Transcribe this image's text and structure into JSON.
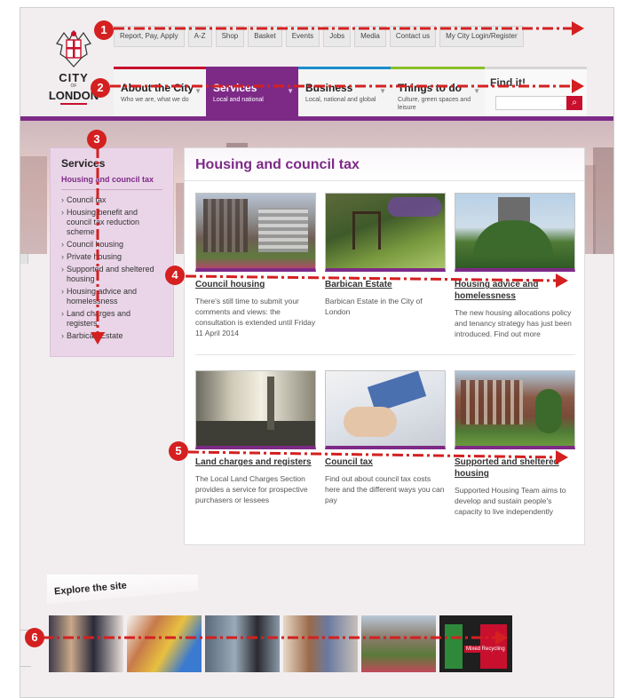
{
  "utility_nav": {
    "items": [
      "Report, Pay, Apply",
      "A-Z",
      "Shop",
      "Basket",
      "Events",
      "Jobs",
      "Media",
      "Contact us",
      "My City Login/Register"
    ]
  },
  "logo": {
    "line1": "CITY",
    "line2": "OF",
    "line3": "LONDON"
  },
  "main_nav": {
    "tabs": [
      {
        "title": "About the City",
        "subtitle": "Who we are, what we do"
      },
      {
        "title": "Services",
        "subtitle": "Local and national"
      },
      {
        "title": "Business",
        "subtitle": "Local, national and global"
      },
      {
        "title": "Things to do",
        "subtitle": "Culture, green spaces and leisure"
      }
    ],
    "find_label": "Find it!",
    "search_placeholder": ""
  },
  "sidebar": {
    "title": "Services",
    "current": "Housing and council tax",
    "items": [
      "Council tax",
      "Housing benefit and council tax reduction scheme",
      "Council housing",
      "Private housing",
      "Supported and sheltered housing",
      "Housing advice and homelessness",
      "Land charges and registers",
      "Barbican Estate"
    ]
  },
  "main": {
    "title": "Housing and council tax",
    "cards": [
      {
        "title": "Council housing",
        "desc": "There's still time to submit your comments and views: the consultation is extended until Friday 11 April 2014"
      },
      {
        "title": "Barbican Estate",
        "desc": "Barbican Estate in the City of London"
      },
      {
        "title": "Housing advice and homelessness",
        "desc": "The new housing allocations policy and tenancy strategy has just been introduced. Find out more"
      },
      {
        "title": "Land charges and registers",
        "desc": "The Local Land Charges Section provides a service for prospective purchasers or lessees"
      },
      {
        "title": "Council tax",
        "desc": "Find out about council tax costs here and the different ways you can pay"
      },
      {
        "title": "Supported and sheltered housing",
        "desc": "Supported Housing Team aims to develop and sustain people's capacity to live independently"
      }
    ]
  },
  "explore": {
    "label": "Explore the site",
    "recycling_label": "Mixed Recycling"
  },
  "annotations": [
    "1",
    "2",
    "3",
    "4",
    "5",
    "6"
  ],
  "colors": {
    "brand_purple": "#7d2a87",
    "brand_red": "#c8102e",
    "annotation_red": "#d42020",
    "business_blue": "#1b8ec9",
    "things_green": "#8cbf2a"
  }
}
